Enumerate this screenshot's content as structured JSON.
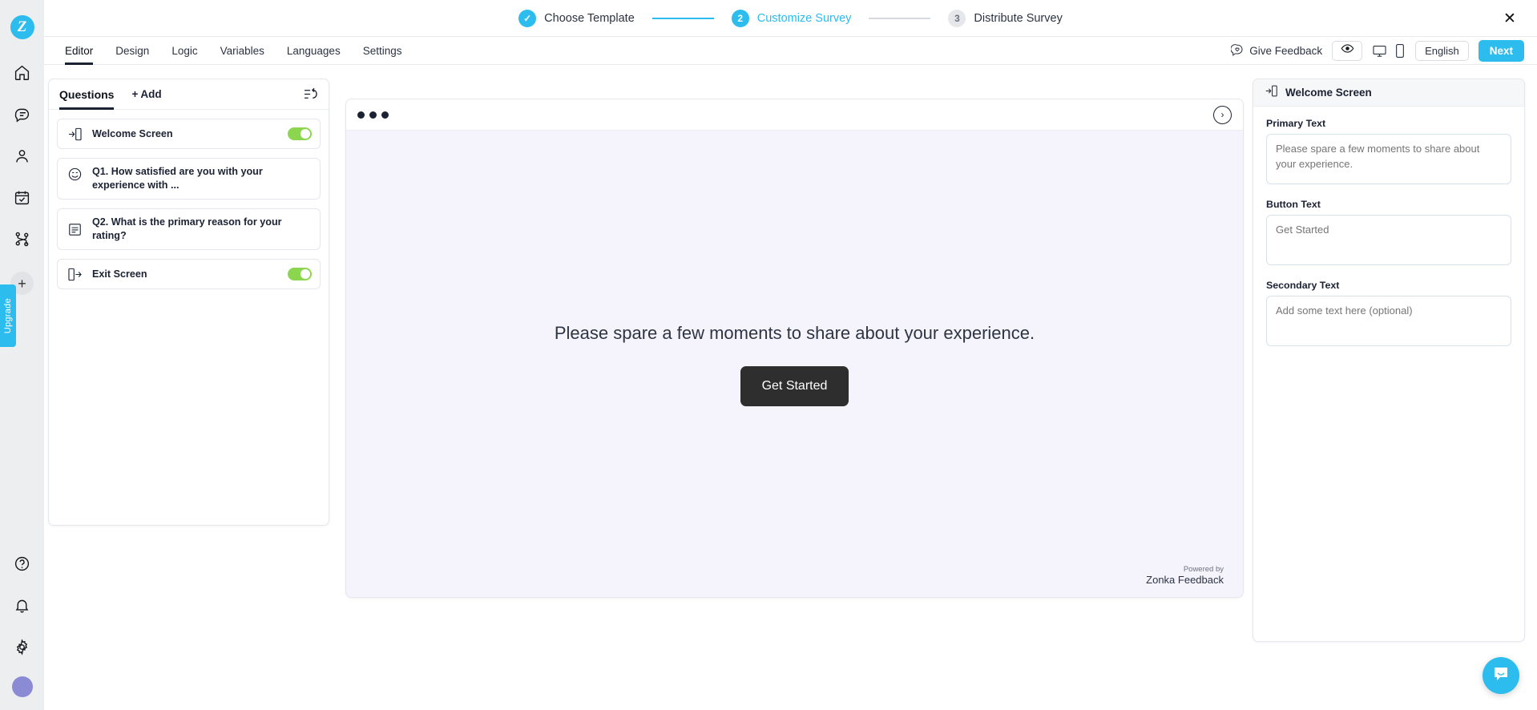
{
  "app": {
    "logo_letter": "Z",
    "close_label": "✕"
  },
  "rail": {
    "icons": [
      {
        "name": "home-icon",
        "label": "Home"
      },
      {
        "name": "feedback-icon",
        "label": "Feedback"
      },
      {
        "name": "contacts-icon",
        "label": "Contacts"
      },
      {
        "name": "tasks-icon",
        "label": "Tasks"
      },
      {
        "name": "workflows-icon",
        "label": "Workflows"
      }
    ],
    "add_label": "+",
    "upgrade_label": "Upgrade",
    "bottom_icons": [
      {
        "name": "help-icon",
        "label": "Help"
      },
      {
        "name": "notifications-icon",
        "label": "Notifications"
      },
      {
        "name": "settings-icon",
        "label": "Settings"
      }
    ]
  },
  "stepper": {
    "steps": [
      {
        "badge": "✓",
        "label": "Choose Template",
        "state": "done"
      },
      {
        "badge": "2",
        "label": "Customize Survey",
        "state": "active"
      },
      {
        "badge": "3",
        "label": "Distribute Survey",
        "state": "idle"
      }
    ]
  },
  "tabbar": {
    "tabs": [
      {
        "label": "Editor",
        "active": true
      },
      {
        "label": "Design",
        "active": false
      },
      {
        "label": "Logic",
        "active": false
      },
      {
        "label": "Variables",
        "active": false
      },
      {
        "label": "Languages",
        "active": false
      },
      {
        "label": "Settings",
        "active": false
      }
    ],
    "give_feedback": "Give Feedback",
    "language": "English",
    "next": "Next"
  },
  "questions_panel": {
    "tab_label": "Questions",
    "add_label": "Add",
    "add_plus": "+",
    "rows": [
      {
        "icon": "enter-screen-icon",
        "label": "Welcome Screen",
        "has_toggle": true
      },
      {
        "icon": "smiley-icon",
        "label": "Q1. How satisfied are you with your experience with ...",
        "has_toggle": false
      },
      {
        "icon": "text-lines-icon",
        "label": "Q2. What is the primary reason for your rating?",
        "has_toggle": false
      },
      {
        "icon": "exit-screen-icon",
        "label": "Exit Screen",
        "has_toggle": true
      }
    ]
  },
  "preview": {
    "primary_text": "Please spare a few moments to share about your experience.",
    "button_text": "Get Started",
    "powered_by_line1": "Powered by",
    "powered_by_line2": "Zonka Feedback",
    "next_arrow": "›"
  },
  "right_panel": {
    "title": "Welcome Screen",
    "fields": [
      {
        "label": "Primary Text",
        "value": "",
        "placeholder": "Please spare a few moments to share about your experience."
      },
      {
        "label": "Button Text",
        "value": "",
        "placeholder": "Get Started"
      },
      {
        "label": "Secondary Text",
        "value": "",
        "placeholder": "Add some text here (optional)"
      }
    ]
  },
  "colors": {
    "brand": "#2cbcee",
    "toggle_on": "#8cd64f",
    "preview_bg": "#f5f4fd",
    "dark": "#1b2233"
  }
}
